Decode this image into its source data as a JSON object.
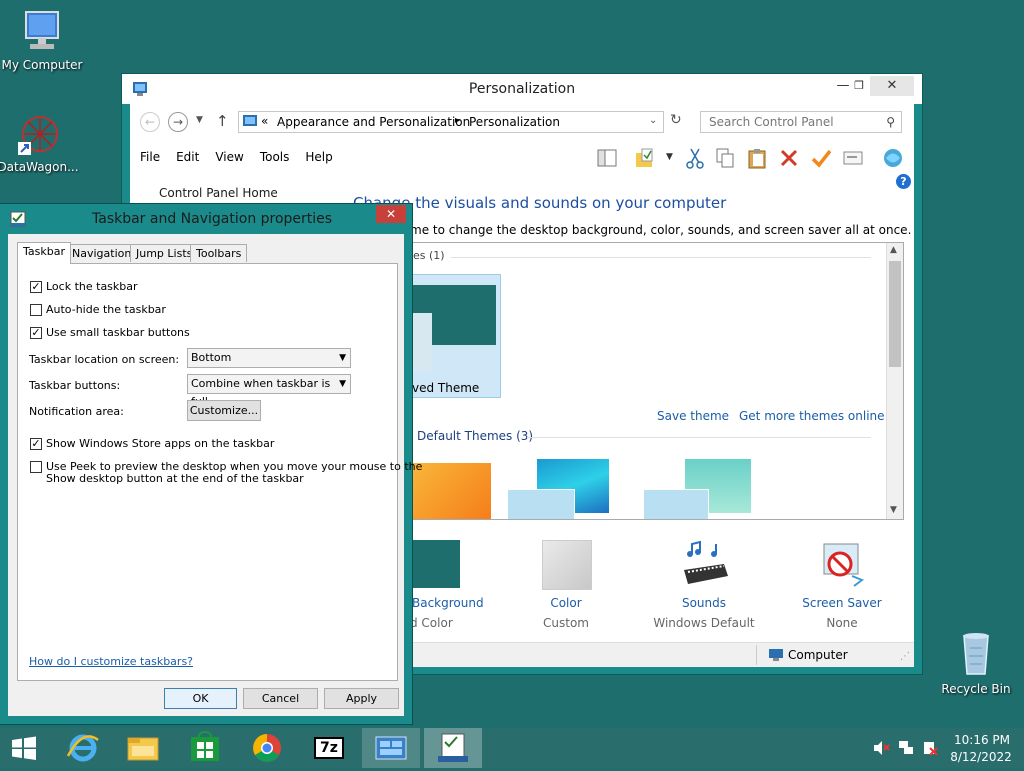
{
  "desktop": {
    "icons": [
      {
        "label": "My Computer"
      },
      {
        "label": "DataWagon..."
      },
      {
        "label": "Recycle Bin"
      }
    ]
  },
  "personalization": {
    "title": "Personalization",
    "breadcrumb": [
      "Appearance and Personalization",
      "Personalization"
    ],
    "breadcrumb_prefix": "«",
    "search_placeholder": "Search Control Panel",
    "menu": [
      "File",
      "Edit",
      "View",
      "Tools",
      "Help"
    ],
    "sidebar_home": "Control Panel Home",
    "heading": "Change the visuals and sounds on your computer",
    "description": "me to change the desktop background, color, sounds, and screen saver all at once.",
    "my_themes_header": "es (1)",
    "saved_theme_label": "ved Theme",
    "save_theme_link": "Save theme",
    "more_themes_link": "Get more themes online",
    "default_themes_header": "Default Themes (3)",
    "bottom": [
      {
        "title": "Background",
        "subtitle": "d Color"
      },
      {
        "title": "Color",
        "subtitle": "Custom"
      },
      {
        "title": "Sounds",
        "subtitle": "Windows Default"
      },
      {
        "title": "Screen Saver",
        "subtitle": "None"
      }
    ],
    "status": "Computer"
  },
  "dialog": {
    "title": "Taskbar and Navigation properties",
    "tabs": [
      "Taskbar",
      "Navigation",
      "Jump Lists",
      "Toolbars"
    ],
    "lock_taskbar": "Lock the taskbar",
    "auto_hide": "Auto-hide the taskbar",
    "small_buttons": "Use small taskbar buttons",
    "location_label": "Taskbar location on screen:",
    "location_value": "Bottom",
    "buttons_label": "Taskbar buttons:",
    "buttons_value": "Combine when taskbar is full",
    "notification_label": "Notification area:",
    "customize_btn": "Customize...",
    "store_apps": "Show Windows Store apps on the taskbar",
    "peek_line1": "Use Peek to preview the desktop when you move your mouse to the",
    "peek_line2": "Show desktop button at the end of the taskbar",
    "help_link": "How do I customize taskbars?",
    "ok": "OK",
    "cancel": "Cancel",
    "apply": "Apply",
    "checks": {
      "lock": true,
      "autohide": false,
      "small": true,
      "store": true,
      "peek": false
    }
  },
  "taskbar": {
    "time": "10:16 PM",
    "date": "8/12/2022",
    "sevenzip": "7z"
  }
}
